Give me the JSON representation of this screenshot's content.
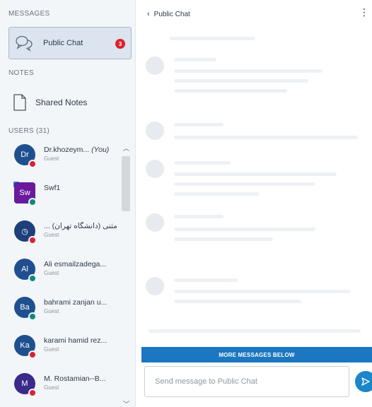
{
  "sidebar": {
    "messages_title": "MESSAGES",
    "public_chat": {
      "label": "Public Chat",
      "unread": "3",
      "icon": "chat-bubbles-icon"
    },
    "notes_title": "NOTES",
    "shared_notes": {
      "label": "Shared Notes",
      "icon": "document-icon"
    },
    "users_title": "USERS (31)",
    "users": [
      {
        "initials": "Dr",
        "name": "Dr.khozeym...",
        "you": "(You)",
        "role": "Guest",
        "avatar_color": "#1f4f8f",
        "status_color": "#d9232e",
        "square": false,
        "presenter": false
      },
      {
        "initials": "Sw",
        "name": "Swf1",
        "you": "",
        "role": "",
        "avatar_color": "#6a1a9c",
        "status_color": "#0f8a7a",
        "square": true,
        "presenter": true
      },
      {
        "initials": "◷",
        "name": "... مثنی (دانشگاه تهران)",
        "you": "",
        "role": "Guest",
        "avatar_color": "#1f3f7a",
        "status_color": "#d9232e",
        "square": false,
        "presenter": false
      },
      {
        "initials": "Al",
        "name": "Ali esmailzadega...",
        "you": "",
        "role": "Guest",
        "avatar_color": "#1f4f8f",
        "status_color": "#0f8a7a",
        "square": false,
        "presenter": false
      },
      {
        "initials": "Ba",
        "name": "bahrami zanjan u...",
        "you": "",
        "role": "Guest",
        "avatar_color": "#1f4f8f",
        "status_color": "#0f8a7a",
        "square": false,
        "presenter": false
      },
      {
        "initials": "Ka",
        "name": "karami hamid rez...",
        "you": "",
        "role": "Guest",
        "avatar_color": "#1f4f8f",
        "status_color": "#d9232e",
        "square": false,
        "presenter": false
      },
      {
        "initials": "M",
        "name": "M. Rostamian--B...",
        "you": "",
        "role": "Guest",
        "avatar_color": "#3a2a8a",
        "status_color": "#d9232e",
        "square": false,
        "presenter": false
      }
    ]
  },
  "chat": {
    "back_label": "Public Chat",
    "more_below": "MORE MESSAGES BELOW",
    "input_placeholder": "Send message to Public Chat"
  },
  "colors": {
    "accent": "#1b86c9",
    "banner": "#1b77c2",
    "badge": "#d9232e"
  }
}
